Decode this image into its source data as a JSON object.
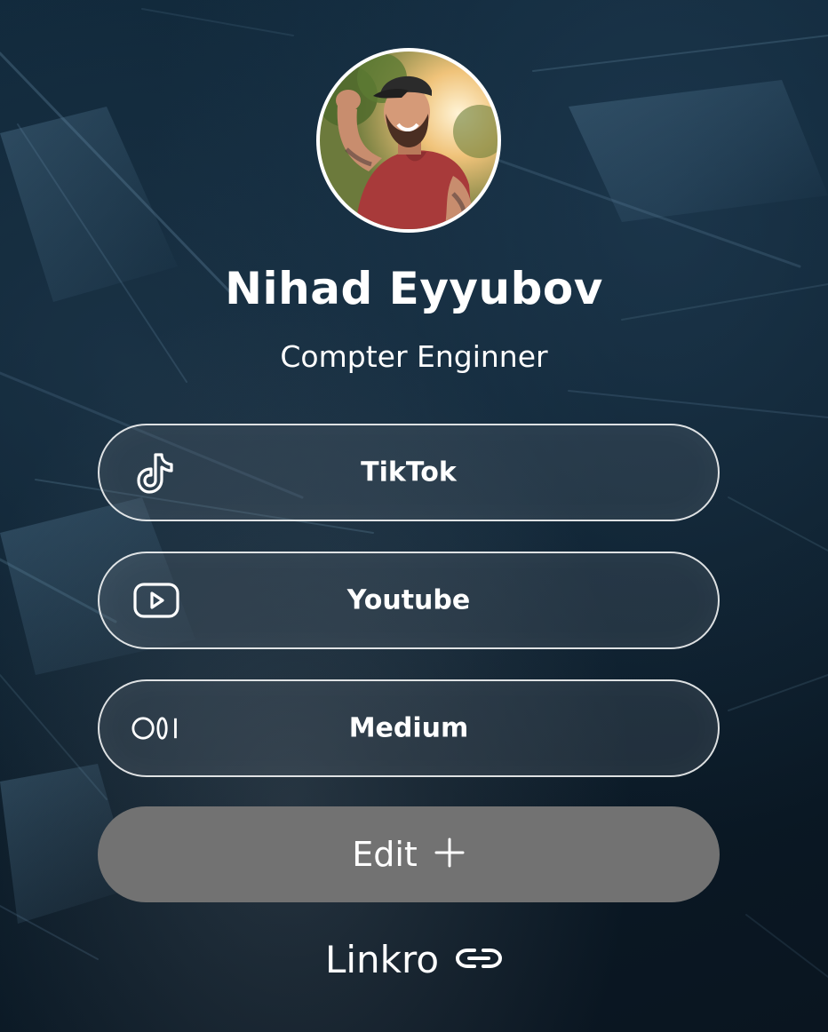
{
  "profile": {
    "name": "Nihad Eyyubov",
    "title": "Compter Enginner"
  },
  "links": [
    {
      "label": "TikTok",
      "icon": "tiktok-icon"
    },
    {
      "label": "Youtube",
      "icon": "youtube-icon"
    },
    {
      "label": "Medium",
      "icon": "medium-icon"
    }
  ],
  "edit": {
    "label": "Edit",
    "icon": "plus-icon"
  },
  "footer": {
    "brand": "Linkro",
    "icon": "link-icon"
  },
  "colors": {
    "background": "#0c2233",
    "button_border": "#ffffff",
    "edit_button": "#727272",
    "text": "#ffffff"
  }
}
